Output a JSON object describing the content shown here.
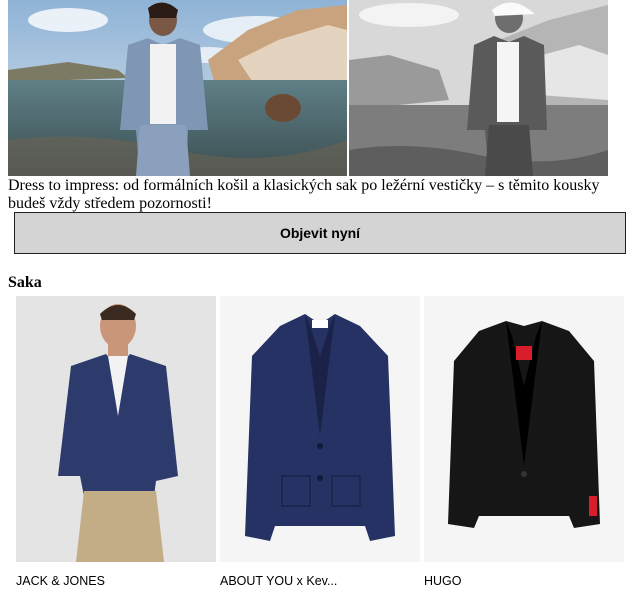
{
  "hero": {
    "images": [
      {
        "name": "hero-image-color"
      },
      {
        "name": "hero-image-bw"
      }
    ]
  },
  "intro": {
    "text": "Dress to impress: od formálních košil a klasických sak po ležérní vestičky – s těmito kousky budeš vždy středem pozornosti!"
  },
  "cta": {
    "label": "Objevit nyní"
  },
  "section": {
    "title": "Saka"
  },
  "products": [
    {
      "brand": "JACK & JONES"
    },
    {
      "brand": "ABOUT YOU x Kev..."
    },
    {
      "brand": "HUGO"
    }
  ],
  "colors": {
    "cta_bg": "#d4d4d4",
    "navy_jacket": "#2a3566",
    "black_jacket": "#181818",
    "hugo_red": "#d81e2a"
  }
}
